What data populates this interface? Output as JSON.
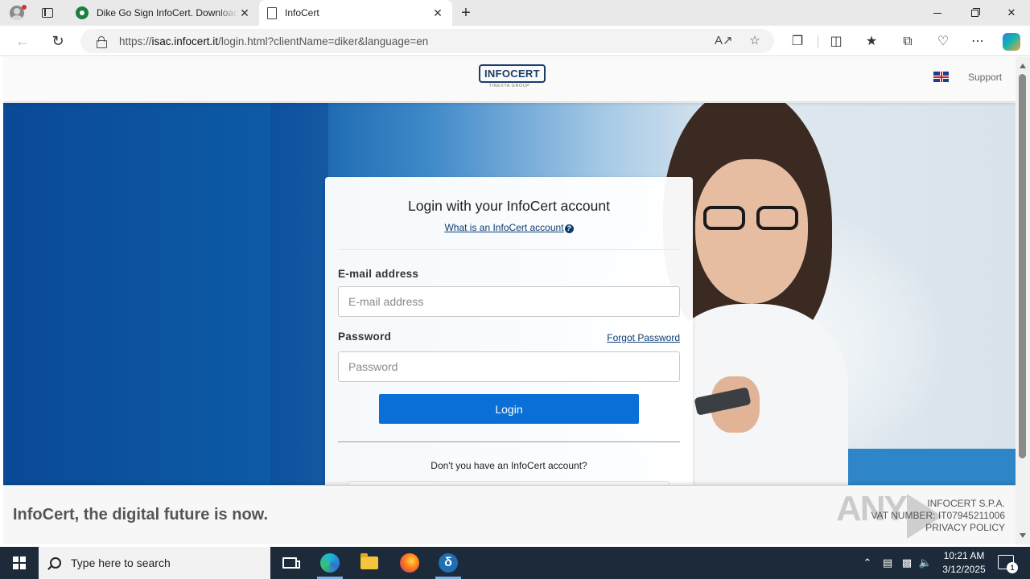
{
  "browser": {
    "tabs": [
      {
        "title": "Dike Go Sign InfoCert. Download",
        "active": false
      },
      {
        "title": "InfoCert",
        "active": true
      }
    ],
    "close_glyph": "✕",
    "new_tab_glyph": "+",
    "url_prefix": "https://",
    "url_host": "isac.infocert.it",
    "url_path": "/login.html?clientName=diker&language=en"
  },
  "site": {
    "logo_text": "INFOCERT",
    "logo_sub": "TINEXTA GROUP",
    "language_flag": "uk-flag-icon",
    "support_label": "Support"
  },
  "login": {
    "title": "Login with your InfoCert account",
    "what_is_link": "What is an InfoCert account",
    "email_label": "E-mail address",
    "email_placeholder": "E-mail address",
    "email_value": "",
    "password_label": "Password",
    "password_placeholder": "Password",
    "password_value": "",
    "forgot_label": "Forgot Password",
    "login_button": "Login",
    "no_account_text": "Don't you have an InfoCert account?"
  },
  "footer": {
    "tagline": "InfoCert, the digital future is now.",
    "company": "INFOCERT S.P.A.",
    "vat": "VAT NUMBER: IT07945211006",
    "privacy": "PRIVACY POLICY"
  },
  "watermark": "ANY",
  "taskbar": {
    "search_placeholder": "Type here to search",
    "time": "10:21 AM",
    "date": "3/12/2025",
    "notification_count": "1"
  },
  "colors": {
    "accent_button": "#0a6fd6",
    "link": "#0b3c73",
    "hero_blue": "#0a4a96"
  }
}
